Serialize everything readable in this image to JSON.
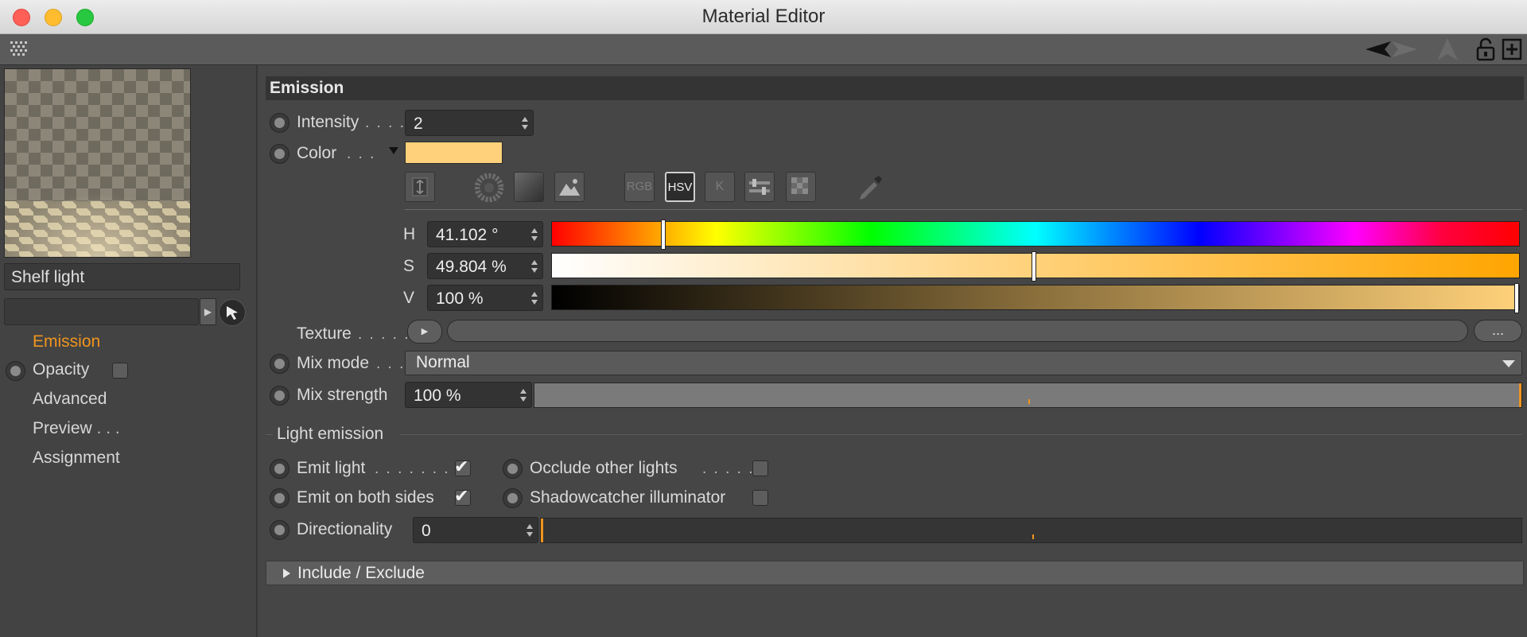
{
  "window": {
    "title": "Material Editor",
    "traffic_lights": {
      "close": "#fe5f57",
      "minimize": "#febc2e",
      "zoom": "#28c840"
    }
  },
  "toolbar": {
    "icons": [
      "grid-menu-icon",
      "arrow-left-icon",
      "arrow-right-icon",
      "up-icon",
      "lock-icon",
      "new-panel-icon"
    ]
  },
  "sidebar": {
    "material_name": "Shelf light",
    "nav": [
      {
        "label": "Emission",
        "active": true,
        "radio": false,
        "checkbox": false
      },
      {
        "label": "Opacity",
        "active": false,
        "radio": true,
        "checkbox": true
      },
      {
        "label": "Advanced",
        "active": false,
        "radio": false,
        "checkbox": false
      },
      {
        "label": "Preview",
        "dots": " . . .",
        "active": false,
        "radio": false,
        "checkbox": false
      },
      {
        "label": "Assignment",
        "active": false,
        "radio": false,
        "checkbox": false
      }
    ]
  },
  "emission": {
    "header": "Emission",
    "intensity": {
      "label": "Intensity",
      "dots": ". . . .",
      "value": "2"
    },
    "color": {
      "label": "Color",
      "dots": ". . .",
      "swatch": "#ffd17a",
      "modes": [
        "RGB",
        "HSV",
        "K"
      ],
      "active_mode": "HSV",
      "mode_icons": [
        "spectrum-icon",
        "color-wheel-icon",
        "gradient-icon",
        "image-icon",
        "rgb-icon",
        "hsv-icon",
        "kelvin-icon",
        "mixer-icon",
        "swatches-icon",
        "eyedropper-icon"
      ],
      "h": {
        "label": "H",
        "value": "41.102 °",
        "fraction": 0.115
      },
      "s": {
        "label": "S",
        "value": "49.804 %",
        "fraction": 0.498
      },
      "v": {
        "label": "V",
        "value": "100 %",
        "fraction": 1.0
      }
    },
    "texture": {
      "label": "Texture",
      "dots": ". . . . .",
      "more": "..."
    },
    "mix_mode": {
      "label": "Mix mode",
      "dots": ". . .",
      "value": "Normal"
    },
    "mix_strength": {
      "label": "Mix strength",
      "value": "100 %",
      "fraction": 1.0
    }
  },
  "light_emission": {
    "group_label": "Light emission",
    "emit_light": {
      "label": "Emit light",
      "dots": ". . . . . . . .",
      "checked": true
    },
    "occlude_other_lights": {
      "label": "Occlude other lights",
      "dots": ". . . . .",
      "checked": false
    },
    "emit_both_sides": {
      "label": "Emit on both sides",
      "checked": true
    },
    "shadowcatcher": {
      "label": "Shadowcatcher illuminator",
      "checked": false
    },
    "directionality": {
      "label": "Directionality",
      "value": "0",
      "fraction": 0.0
    }
  },
  "include_exclude": {
    "label": "Include / Exclude"
  },
  "colors": {
    "accent": "#f0951e",
    "panel_bg": "#464646",
    "field_bg": "#333333"
  }
}
